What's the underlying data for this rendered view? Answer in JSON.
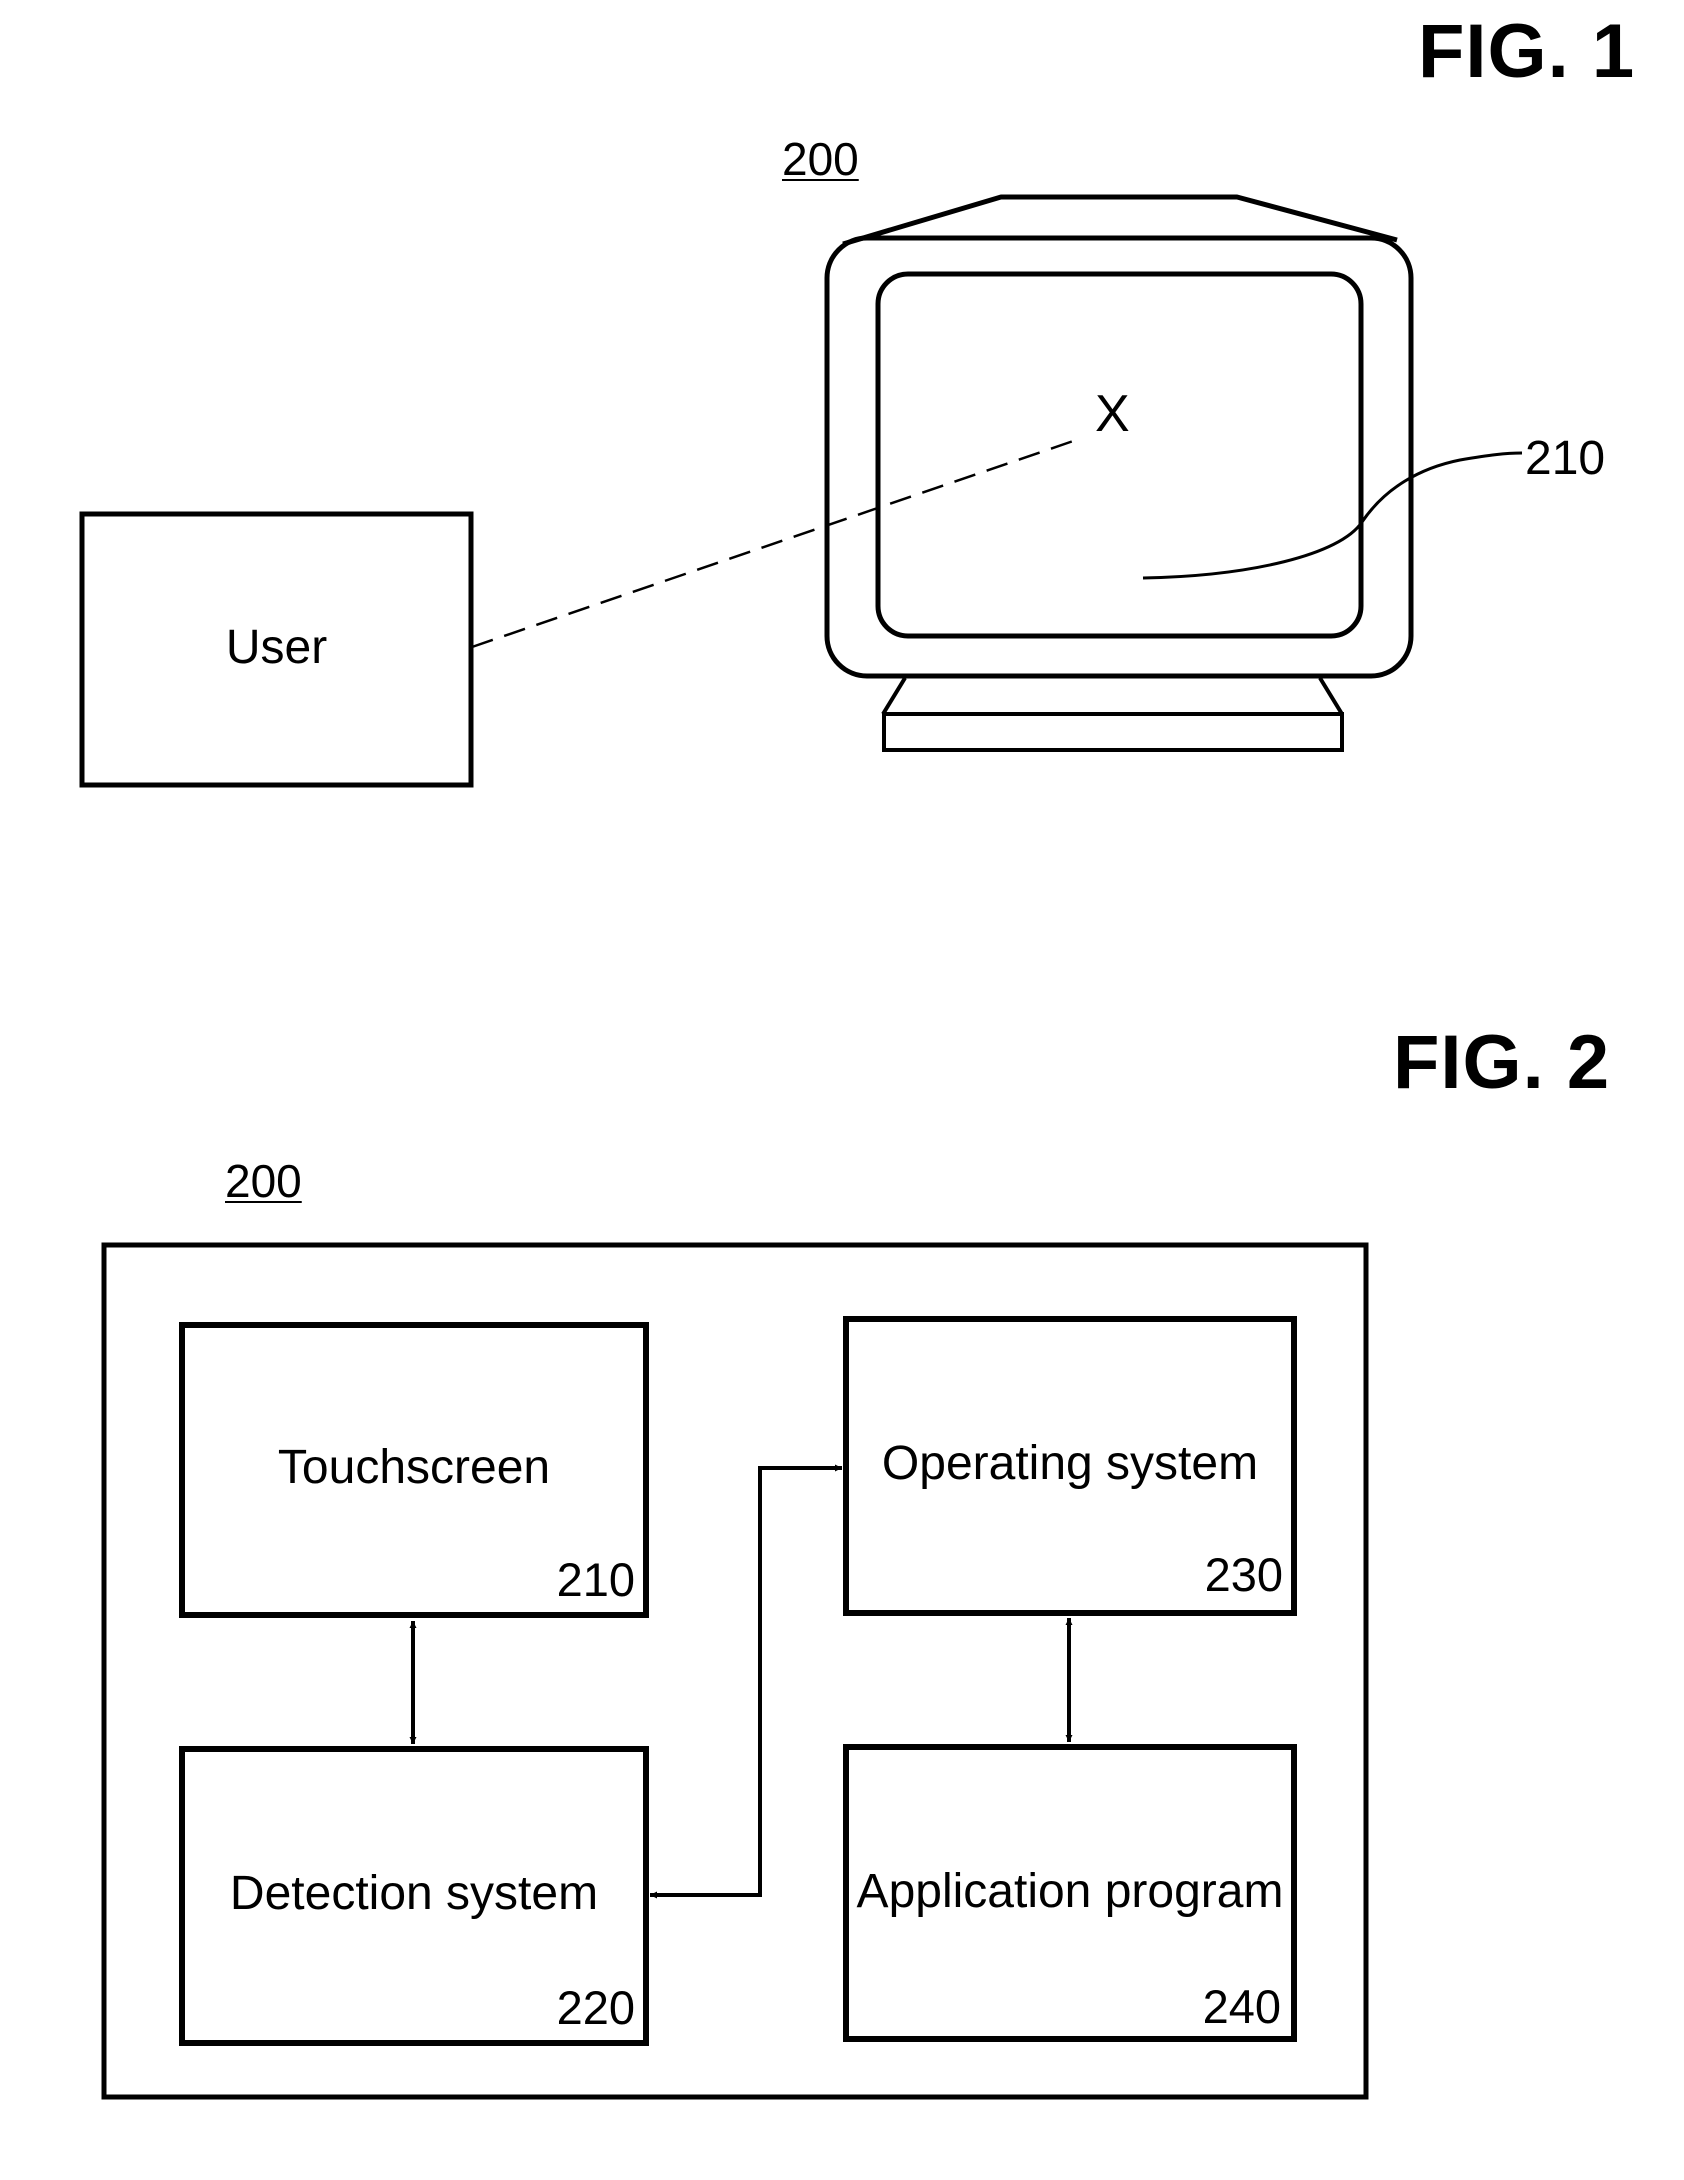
{
  "figure1": {
    "title": "FIG. 1",
    "device_ref": "200",
    "user_label": "User",
    "target_mark": "X",
    "screen_ref": "210"
  },
  "figure2": {
    "title": "FIG. 2",
    "device_ref": "200",
    "blocks": [
      {
        "label": "Touchscreen",
        "number": "210"
      },
      {
        "label": "Detection system",
        "number": "220"
      },
      {
        "label": "Operating system",
        "number": "230"
      },
      {
        "label": "Application program",
        "number": "240"
      }
    ],
    "connections": [
      {
        "from": "Touchscreen",
        "to": "Detection system",
        "type": "bidirectional"
      },
      {
        "from": "Detection system",
        "to": "Operating system",
        "type": "bidirectional"
      },
      {
        "from": "Operating system",
        "to": "Application program",
        "type": "bidirectional"
      }
    ]
  }
}
